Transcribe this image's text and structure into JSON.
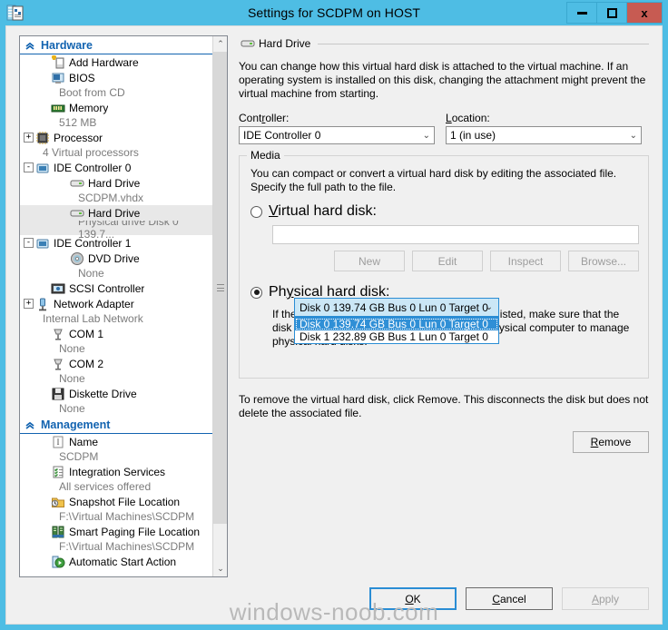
{
  "window": {
    "title": "Settings for SCDPM on HOST",
    "icon": "settings-document-icon",
    "minimize_label": "–",
    "maximize_label": "□",
    "close_label": "x",
    "titlebar_color": "#4ebde4",
    "close_color": "#c75b52"
  },
  "sidebar": {
    "sections": [
      {
        "title": "Hardware",
        "chevron": "«",
        "items": [
          {
            "label": "Add Hardware",
            "sub": null,
            "indent": 1,
            "expander": "none",
            "icon": "add-hardware-icon",
            "selected": false
          },
          {
            "label": "BIOS",
            "sub": "Boot from CD",
            "indent": 1,
            "expander": "none",
            "icon": "bios-icon",
            "selected": false
          },
          {
            "label": "Memory",
            "sub": "512 MB",
            "indent": 1,
            "expander": "none",
            "icon": "memory-icon",
            "selected": false
          },
          {
            "label": "Processor",
            "sub": "4 Virtual processors",
            "indent": 0,
            "expander": "+",
            "icon": "processor-icon",
            "selected": false
          },
          {
            "label": "IDE Controller 0",
            "sub": null,
            "indent": 0,
            "expander": "-",
            "icon": "ide-controller-icon",
            "selected": false
          },
          {
            "label": "Hard Drive",
            "sub": "SCDPM.vhdx",
            "indent": 2,
            "expander": "none",
            "icon": "hard-drive-icon",
            "selected": false
          },
          {
            "label": "Hard Drive",
            "sub": "Physical drive Disk 0 139.7...",
            "indent": 2,
            "expander": "none",
            "icon": "hard-drive-icon",
            "selected": true
          },
          {
            "label": "IDE Controller 1",
            "sub": null,
            "indent": 0,
            "expander": "-",
            "icon": "ide-controller-icon",
            "selected": false
          },
          {
            "label": "DVD Drive",
            "sub": "None",
            "indent": 2,
            "expander": "none",
            "icon": "dvd-drive-icon",
            "selected": false
          },
          {
            "label": "SCSI Controller",
            "sub": null,
            "indent": 1,
            "expander": "none",
            "icon": "scsi-controller-icon",
            "selected": false
          },
          {
            "label": "Network Adapter",
            "sub": "Internal Lab Network",
            "indent": 0,
            "expander": "+",
            "icon": "network-adapter-icon",
            "selected": false
          },
          {
            "label": "COM 1",
            "sub": "None",
            "indent": 1,
            "expander": "none",
            "icon": "com-port-icon",
            "selected": false
          },
          {
            "label": "COM 2",
            "sub": "None",
            "indent": 1,
            "expander": "none",
            "icon": "com-port-icon",
            "selected": false
          },
          {
            "label": "Diskette Drive",
            "sub": "None",
            "indent": 1,
            "expander": "none",
            "icon": "diskette-drive-icon",
            "selected": false
          }
        ]
      },
      {
        "title": "Management",
        "chevron": "«",
        "items": [
          {
            "label": "Name",
            "sub": "SCDPM",
            "indent": 1,
            "expander": "none",
            "icon": "name-icon",
            "selected": false
          },
          {
            "label": "Integration Services",
            "sub": "All services offered",
            "indent": 1,
            "expander": "none",
            "icon": "integration-services-icon",
            "selected": false
          },
          {
            "label": "Snapshot File Location",
            "sub": "F:\\Virtual Machines\\SCDPM",
            "indent": 1,
            "expander": "none",
            "icon": "snapshot-folder-icon",
            "selected": false
          },
          {
            "label": "Smart Paging File Location",
            "sub": "F:\\Virtual Machines\\SCDPM",
            "indent": 1,
            "expander": "none",
            "icon": "smart-paging-icon",
            "selected": false
          },
          {
            "label": "Automatic Start Action",
            "sub": null,
            "indent": 1,
            "expander": "none",
            "icon": "automatic-start-icon",
            "selected": false
          }
        ]
      }
    ],
    "scroll_up": "⌃",
    "scroll_down": "⌄"
  },
  "pane": {
    "header": "Hard Drive",
    "header_icon": "hard-drive-icon",
    "description": "You can change how this virtual hard disk is attached to the virtual machine. If an operating system is installed on this disk, changing the attachment might prevent the virtual machine from starting.",
    "controller": {
      "label": "Controller:",
      "value": "IDE Controller 0",
      "arrow": "⌄"
    },
    "location": {
      "label": "Location:",
      "value": "1 (in use)",
      "arrow": "⌄"
    },
    "media": {
      "title": "Media",
      "description": "You can compact or convert a virtual hard disk by editing the associated file. Specify the full path to the file.",
      "virtual_hard_disk": {
        "label": "Virtual hard disk:",
        "selected": false,
        "path_value": "",
        "path_placeholder": ""
      },
      "vhd_buttons": [
        {
          "label": "New",
          "enabled": false
        },
        {
          "label": "Edit",
          "enabled": false
        },
        {
          "label": "Inspect",
          "enabled": false
        },
        {
          "label": "Browse...",
          "enabled": false
        }
      ],
      "physical_hard_disk": {
        "label": "Physical hard disk:",
        "selected": true,
        "selected_value": "Disk 0  139.74 GB Bus 0 Lun 0 Target 0",
        "dropdown_open": true,
        "arrow": "⌄",
        "options": [
          {
            "label": "Disk 0  139.74 GB Bus 0 Lun 0 Target 0",
            "highlighted": true
          },
          {
            "label": "Disk 1 232.89 GB Bus 1 Lun 0 Target 0",
            "highlighted": false
          }
        ],
        "hint": "If the physical hard disk you want to use is not listed, make sure that the disk is offline. Use Disk Management on the physical computer to manage physical hard disks."
      }
    },
    "remove_description": "To remove the virtual hard disk, click Remove. This disconnects the disk but does not delete the associated file.",
    "remove_button": "Remove"
  },
  "footer": {
    "buttons": [
      {
        "label": "OK",
        "state": "focused"
      },
      {
        "label": "Cancel",
        "state": "normal"
      },
      {
        "label": "Apply",
        "state": "disabled"
      }
    ]
  },
  "watermark": "windows-noob.com"
}
